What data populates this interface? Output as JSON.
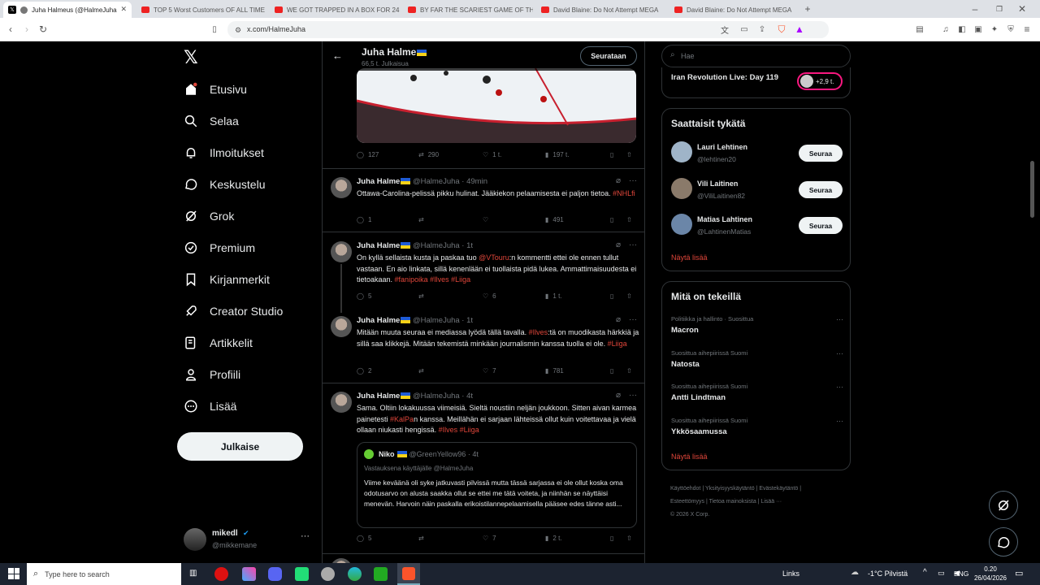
{
  "browser": {
    "tabs": [
      {
        "label": "Juha Halmeus (@HalmeJuha",
        "active": true
      },
      {
        "label": "TOP 5 Worst Customers OF ALL TIME"
      },
      {
        "label": "WE GOT TRAPPED IN A BOX FOR 24 H"
      },
      {
        "label": "BY FAR THE SCARIEST GAME OF THE"
      },
      {
        "label": "David Blaine: Do Not Attempt MEGA"
      },
      {
        "label": "David Blaine: Do Not Attempt MEGA"
      }
    ],
    "url": "x.com/HalmeJuha"
  },
  "nav": {
    "items": [
      "Etusivu",
      "Selaa",
      "Ilmoitukset",
      "Keskustelu",
      "Grok",
      "Premium",
      "Kirjanmerkit",
      "Creator Studio",
      "Artikkelit",
      "Profiili",
      "Lisää"
    ],
    "post_label": "Julkaise",
    "account_name": "mikedl",
    "account_handle": "@mikkemane"
  },
  "profile_header": {
    "name": "Juha Halme",
    "subtitle": "66,5 t. Julkaisua",
    "following_label": "Seurataan"
  },
  "top_tweet_actions": {
    "replies": "127",
    "retweets": "290",
    "likes": "1 t.",
    "views": "197 t."
  },
  "tweets": [
    {
      "name": "Juha Halme",
      "handle": "@HalmeJuha · 49min",
      "text_parts": [
        "Ottawa-Carolina-pelissä pikku hulinat. Jääkiekon pelaamisesta ei paljon tietoa. ",
        "#NHLfi"
      ],
      "replies": "1",
      "retweets": "",
      "likes": "",
      "views": "491"
    },
    {
      "name": "Juha Halme",
      "handle": "@HalmeJuha · 1t",
      "text_a": "On kyllä sellaista kusta ja paskaa tuo ",
      "mention": "@VTouru",
      "text_b": ":n kommentti ettei ole ennen tullut vastaan. En aio linkata, sillä kenenlään ei tuollaista pidä lukea. Ammattimaisuudesta ei tietoakaan. ",
      "tags": "#fanipoika #Ilves #Liiga",
      "replies": "5",
      "retweets": "",
      "likes": "6",
      "views": "1 t."
    },
    {
      "name": "Juha Halme",
      "handle": "@HalmeJuha · 1t",
      "text_a": "Mitään muuta seuraa ei mediassa lyödä tällä tavalla. ",
      "tag1": "#Ilves",
      "text_b": ":tä on muodikasta härkkiä ja sillä saa klikkejä. Mitään tekemistä minkään journalismin kanssa tuolla ei ole. ",
      "tag2": "#Liiga",
      "replies": "2",
      "retweets": "",
      "likes": "7",
      "views": "781"
    },
    {
      "name": "Juha Halme",
      "handle": "@HalmeJuha · 4t",
      "text_a": "Sama. Oltiin lokakuussa viimeisiä. Sieltä noustiin neljän joukkoon. Sitten aivan karmea painetesti ",
      "tag1": "#KalPa",
      "text_b": "n kanssa. Meillähän ei sarjaan lähteissä ollut kuin voitettavaa ja vielä ollaan niukasti hengissä. ",
      "tags": "#Ilves #Liiga",
      "quote": {
        "name": "Niko",
        "handle": "@GreenYellow96 · 4t",
        "reply_to": "Vastauksena käyttäjälle @HalmeJuha",
        "text": "Viime keväänä oli syke jatkuvasti pilvissä mutta tässä sarjassa ei ole ollut koska oma odotusarvo on alusta saakka ollut se ettei me tätä voiteta, ja niinhän se näyttäisi menevän. Harvoin näin paskalla erikoistilannepelaamisella pääsee edes tänne asti..."
      },
      "replies": "5",
      "retweets": "",
      "likes": "7",
      "views": "2 t."
    }
  ],
  "right": {
    "search_placeholder": "Hae",
    "live_title": "Iran Revolution Live: Day 119",
    "live_count": "+2,9 t.",
    "wtf_title": "Saattaisit tykätä",
    "suggestions": [
      {
        "name": "Lauri Lehtinen",
        "handle": "@lehtinen20",
        "button": "Seuraa"
      },
      {
        "name": "Vili Laitinen",
        "handle": "@ViliLaitinen82",
        "button": "Seuraa"
      },
      {
        "name": "Matias Lahtinen",
        "handle": "@LahtinenMatias",
        "button": "Seuraa"
      }
    ],
    "show_more": "Näytä lisää",
    "trends_title": "Mitä on tekeillä",
    "trends": [
      {
        "meta": "Politiikka ja hallinto · Suosittua",
        "name": "Macron"
      },
      {
        "meta": "Suosittua aihepiirissä Suomi",
        "name": "Natosta"
      },
      {
        "meta": "Suosittua aihepiirissä Suomi",
        "name": "Antti Lindtman"
      },
      {
        "meta": "Suosittua aihepiirissä Suomi",
        "name": "Ykkösaamussa"
      }
    ],
    "trends_more": "Näytä lisää",
    "footer_line1": [
      "Käyttöehdot",
      "Yksityisyyskäytäntö",
      "Evästekäytäntö"
    ],
    "footer_line2": [
      "Esteettömyys",
      "Tietoa mainoksista",
      "Lisää ···"
    ],
    "copyright": "© 2026 X Corp."
  },
  "taskbar": {
    "search_placeholder": "Type here to search",
    "links": "Links",
    "weather": "-1°C  Pilvistä",
    "lang": "ENG",
    "time": "0.20",
    "date": "26/04/2026"
  }
}
